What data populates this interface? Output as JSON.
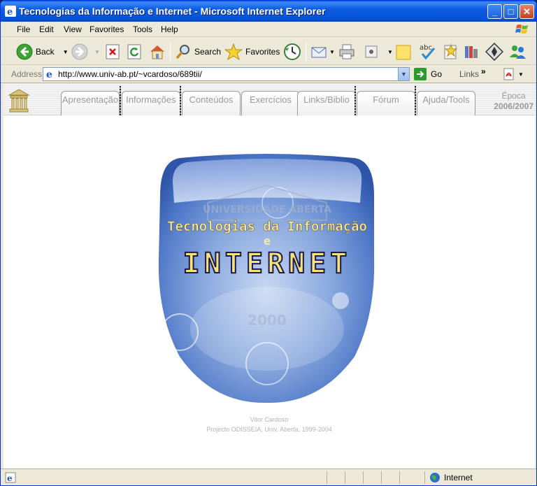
{
  "window": {
    "title": "Tecnologias da Informação e Internet - Microsoft Internet Explorer",
    "minimize": "_",
    "maximize": "□",
    "close": "✕"
  },
  "menu": {
    "items": [
      "File",
      "Edit",
      "View",
      "Favorites",
      "Tools",
      "Help"
    ]
  },
  "toolbar": {
    "back_label": "Back",
    "search_label": "Search",
    "favorites_label": "Favorites"
  },
  "address": {
    "label": "Address",
    "url": "http://www.univ-ab.pt/~vcardoso/689tii/",
    "go_label": "Go",
    "links_label": "Links",
    "links_chevron": "»"
  },
  "site": {
    "tabs": [
      "Apresentação",
      "Informações",
      "Conteúdos",
      "Exercícios",
      "Links/Biblio",
      "Fórum",
      "Ajuda/Tools"
    ],
    "epoca_label": "Época",
    "epoca_value": "2006/2007",
    "hero": {
      "line1": "Tecnologias da Informação",
      "line2": "e",
      "line3": "INTERNET",
      "watermark": "UNIVERSIDADE ABERTA",
      "watermark_year": "2000"
    },
    "credit_author": "Vitor Cardoso",
    "credit_project": "Projecto ODISSEIA, Univ. Aberta, 1999-2004"
  },
  "status": {
    "zone_label": "Internet"
  },
  "colors": {
    "titlebar": "#0453d8",
    "hero_blue": "#3f6fc2",
    "hero_text_yellow": "#f4ecaa"
  }
}
